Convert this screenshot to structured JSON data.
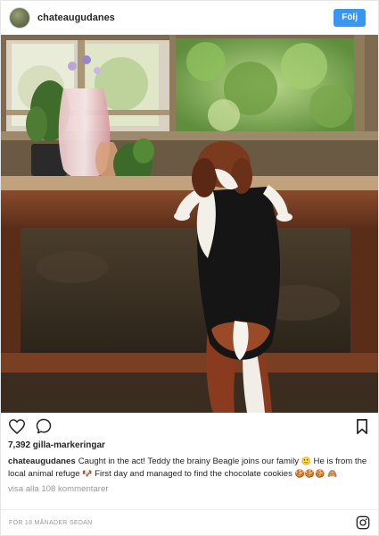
{
  "header": {
    "username": "chateaugudanes",
    "follow_label": "Följ"
  },
  "photo": {
    "alt": "Beagle standing on hind legs looking over a wooden windowsill"
  },
  "actions": {
    "like_icon": "heart-icon",
    "comment_icon": "comment-icon",
    "save_icon": "bookmark-icon"
  },
  "likes": "7,392 gilla-markeringar",
  "caption": {
    "username": "chateaugudanes",
    "text_part1": "Caught in the act! Teddy the brainy Beagle joins our family ",
    "emoji1": "🙂",
    "text_part2": " He is from the local animal refuge ",
    "emoji2": "🐶",
    "text_part3": " First day and managed to find the chocolate cookies ",
    "emoji3": "🍪🍪🍪 🙈"
  },
  "view_comments": "visa alla 108 kommentarer",
  "timestamp": "FÖR 18 MÅNADER SEDAN",
  "footer_icon": "instagram-icon",
  "colors": {
    "accent": "#3897f0",
    "text": "#262626",
    "muted": "#999999"
  }
}
